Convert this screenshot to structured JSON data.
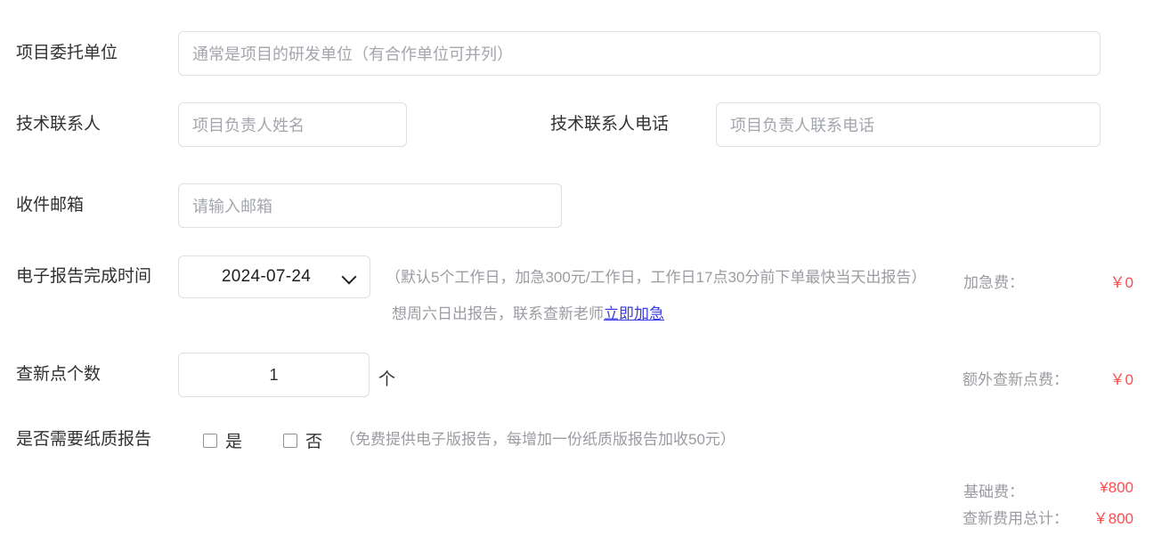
{
  "form": {
    "rows": [
      {
        "label": "项目委托单位",
        "placeholder": "通常是项目的研发单位（有合作单位可并列）"
      },
      {
        "label": "技术联系人",
        "placeholder": "项目负责人姓名",
        "label2": "技术联系人电话",
        "placeholder2": "项目负责人联系电话"
      },
      {
        "label": "收件邮箱",
        "placeholder": "请输入邮箱"
      },
      {
        "label": "电子报告完成时间",
        "value": "2024-07-24",
        "hint_line1": "（默认5个工作日，加急300元/工作日，工作日17点30分前下单最快当天出报告）",
        "hint_line2_prefix": "想周六日出报告，联系查新老师",
        "hint_line2_link": "立即加急"
      },
      {
        "label": "查新点个数",
        "value": "1",
        "unit": "个"
      },
      {
        "label": "是否需要纸质报告",
        "option_yes": "是",
        "option_no": "否",
        "hint": "（免费提供电子版报告，每增加一份纸质版报告加收50元）"
      }
    ]
  },
  "fees": {
    "rush_label": "加急费：",
    "rush_value": "￥0",
    "extra_point_label": "额外查新点费：",
    "extra_point_value": "￥0",
    "base_label": "基础费：",
    "base_value": "¥800",
    "total_label": "查新费用总计：",
    "total_value": "￥800"
  },
  "icons": {
    "select_chevron": "chevron-down-icon"
  },
  "colors": {
    "label_text": "#303133",
    "placeholder": "#a3a6ad",
    "border": "#dcdfe6",
    "hint": "#9a9ca1",
    "price": "#ff4d4f",
    "link": "#3a3ae0"
  }
}
